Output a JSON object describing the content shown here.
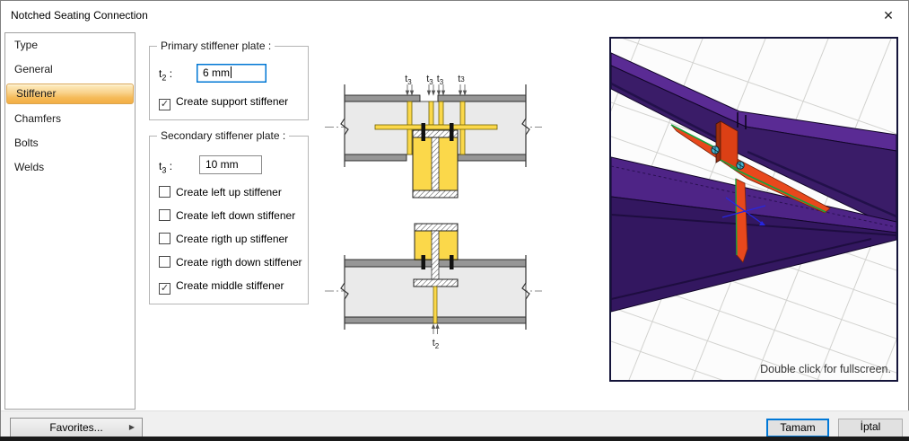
{
  "window": {
    "title": "Notched Seating Connection"
  },
  "icons": {
    "close": "✕",
    "check": "✓",
    "arrow_right": "▶"
  },
  "sidebar": {
    "items": [
      {
        "label": "Type",
        "selected": false
      },
      {
        "label": "General",
        "selected": false
      },
      {
        "label": "Stiffener",
        "selected": true
      },
      {
        "label": "Chamfers",
        "selected": false
      },
      {
        "label": "Bolts",
        "selected": false
      },
      {
        "label": "Welds",
        "selected": false
      }
    ]
  },
  "primary_group": {
    "title": "Primary stiffener plate :",
    "param": {
      "base": "t",
      "sub": "2",
      "colon": ":"
    },
    "input_value": "6 mm",
    "checkbox_label": "Create support stiffener",
    "checkbox_checked": true
  },
  "secondary_group": {
    "title": "Secondary stiffener plate :",
    "param": {
      "base": "t",
      "sub": "3",
      "colon": ":"
    },
    "input_value": "10 mm",
    "checkboxes": [
      {
        "label": "Create left up stiffener",
        "checked": false
      },
      {
        "label": "Create left down stiffener",
        "checked": false
      },
      {
        "label": "Create rigth up stiffener",
        "checked": false
      },
      {
        "label": "Create rigth down stiffener",
        "checked": false
      },
      {
        "label": "Create middle stiffener",
        "checked": true
      }
    ]
  },
  "diagram": {
    "t": "t",
    "t3_sub": "3",
    "t2_sub": "2",
    "colors": {
      "plate_yellow": "#fbd84a",
      "beam_body": "#eaeaea",
      "flange_gray": "#969696"
    }
  },
  "preview3d": {
    "hint": "Double click for fullscreen.",
    "colors": {
      "beam_purple_top": "#54288e",
      "beam_purple_front": "#3a1c68",
      "plate_orange": "#e8481c",
      "edge_green": "#15a33c",
      "bolt_cyan": "#47b7d2"
    }
  },
  "footer": {
    "favorites": "Favorites...",
    "ok": "Tamam",
    "cancel": "İptal"
  }
}
